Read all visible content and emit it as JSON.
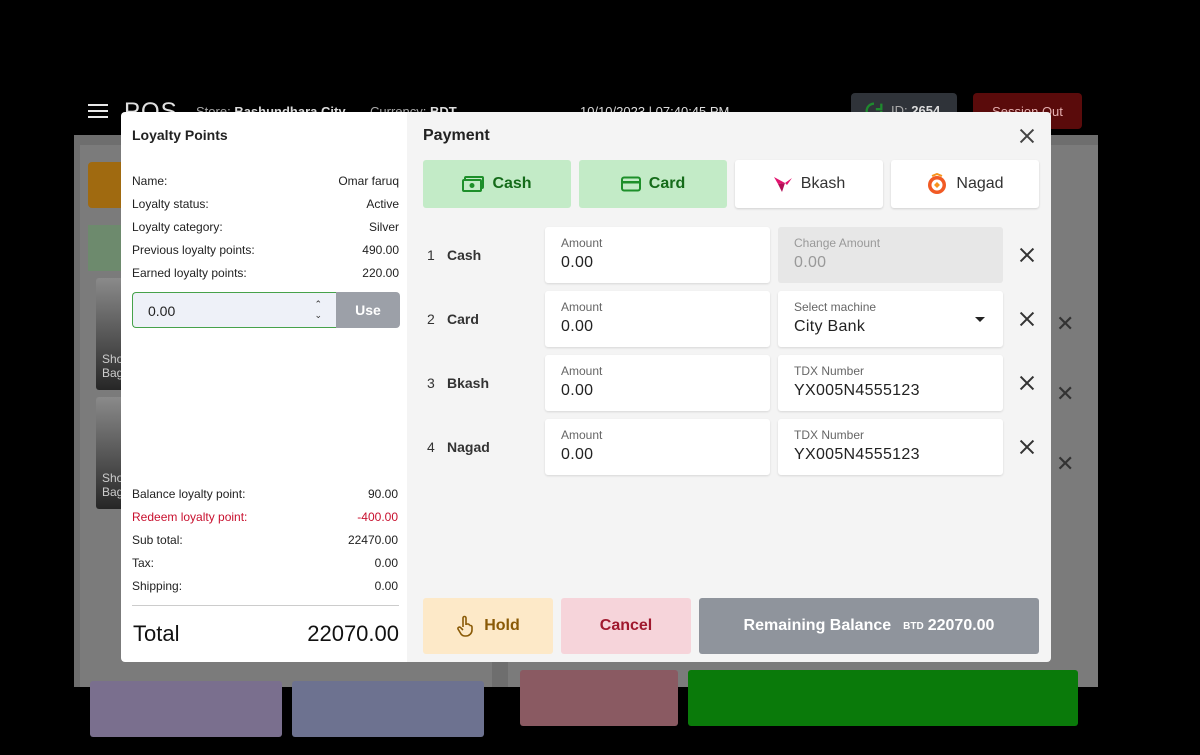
{
  "background": {
    "brand": "POS",
    "store_label": "Store:",
    "store_value": "Bashundhara City",
    "currency_label": "Currency:",
    "currency_value": "BDT",
    "datetime": "10/10/2023 | 07:40:45 PM",
    "id_label": "ID:",
    "id_value": "2654",
    "session_button": "Session Out",
    "products": [
      "Shop Bag",
      "Shop Bag"
    ]
  },
  "loyalty": {
    "title": "Loyalty Points",
    "info": [
      {
        "label": "Name:",
        "value": "Omar faruq"
      },
      {
        "label": "Loyalty status:",
        "value": "Active"
      },
      {
        "label": "Loyalty category:",
        "value": "Silver"
      },
      {
        "label": "Previous loyalty points:",
        "value": "490.00"
      },
      {
        "label": "Earned loyalty points:",
        "value": "220.00"
      }
    ],
    "input_value": "0.00",
    "use_button": "Use",
    "summary": [
      {
        "label": "Balance loyalty point:",
        "value": "90.00"
      },
      {
        "label": "Redeem loyalty point:",
        "value": "-400.00"
      },
      {
        "label": "Sub total:",
        "value": "22470.00"
      },
      {
        "label": "Tax:",
        "value": "0.00"
      },
      {
        "label": "Shipping:",
        "value": "0.00"
      }
    ],
    "total_label": "Total",
    "total_value": "22070.00"
  },
  "payment": {
    "title": "Payment",
    "methods": [
      {
        "label": "Cash",
        "active": true
      },
      {
        "label": "Card",
        "active": true
      },
      {
        "label": "Bkash",
        "active": false
      },
      {
        "label": "Nagad",
        "active": false
      }
    ],
    "rows": [
      {
        "num": "1",
        "name": "Cash",
        "amount_label": "Amount",
        "amount": "0.00",
        "second_label": "Change Amount",
        "second_value": "0.00"
      },
      {
        "num": "2",
        "name": "Card",
        "amount_label": "Amount",
        "amount": "0.00",
        "second_label": "Select machine",
        "second_value": "City Bank"
      },
      {
        "num": "3",
        "name": "Bkash",
        "amount_label": "Amount",
        "amount": "0.00",
        "second_label": "TDX Number",
        "second_value": "YX005N4555123"
      },
      {
        "num": "4",
        "name": "Nagad",
        "amount_label": "Amount",
        "amount": "0.00",
        "second_label": "TDX Number",
        "second_value": "YX005N4555123"
      }
    ],
    "hold_button": "Hold",
    "cancel_button": "Cancel",
    "remaining_label": "Remaining Balance",
    "remaining_currency": "BTD",
    "remaining_value": "22070.00"
  },
  "colors": {
    "active_method_bg": "#c3ebc7",
    "hold_bg": "#fde9c8",
    "cancel_bg": "#f6d4da",
    "remaining_bg": "#8f949c",
    "redeem_text": "#c8102e"
  }
}
